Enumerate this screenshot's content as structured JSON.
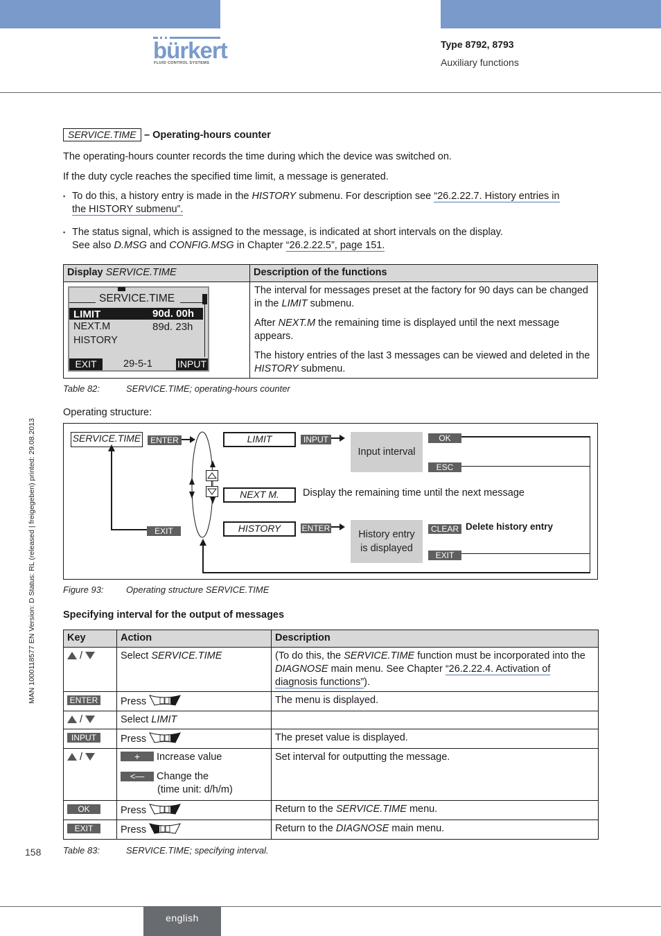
{
  "header": {
    "brand": "bürkert",
    "brand_tagline": "FLUID CONTROL SYSTEMS",
    "doc_type": "Type 8792, 8793",
    "section": "Auxiliary functions",
    "colors": {
      "band": "#7a9acb",
      "key_bg": "#5f5f5f",
      "gray_box": "#cfcfcf",
      "link_underline": "#4f79b8"
    }
  },
  "side_note": "MAN  1000118577  EN  Version: D  Status: RL (released | freigegeben)  printed: 29.08.2013",
  "intro": {
    "function_box": "SERVICE.TIME",
    "heading": "– Operating-hours counter",
    "p1": "The operating-hours counter records the time during which the device was switched on.",
    "p2": "If the duty cycle reaches the specified time limit, a message is generated.",
    "bullet1": {
      "pre": "To do this, a history entry is made in the ",
      "em": "HISTORY",
      "mid": " submenu. For description see ",
      "link1": "“26.2.22.7. History entries in ",
      "link2": "the HISTORY submenu”."
    },
    "bullet2": {
      "line1": "The status signal, which is assigned to the message, is indicated at short intervals on the display.",
      "pre": "See also ",
      "em1": "D.MSG",
      "and": " and ",
      "em2": "CONFIG.MSG",
      "mid": " in Chapter ",
      "link": "“26.2.22.5”, page 151."
    }
  },
  "table82": {
    "header_display": "Display ",
    "header_display_em": "SERVICE.TIME",
    "header_desc": "Description of the functions",
    "lcd": {
      "title": "SERVICE.TIME",
      "rows": [
        {
          "label": "LIMIT",
          "value": "90d. 00h",
          "selected": true
        },
        {
          "label": "NEXT.M",
          "value": "89d. 23h",
          "selected": false
        },
        {
          "label": "HISTORY",
          "value": "",
          "selected": false
        }
      ],
      "left_key": "EXIT",
      "code": "29-5-1",
      "right_key": "INPUT"
    },
    "desc": [
      {
        "pre": "The interval for messages preset at the factory for 90 days can be changed in the ",
        "em": "LIMIT",
        "post": " submenu."
      },
      {
        "pre": "After ",
        "em": "NEXT.M",
        "post": " the remaining time is displayed until the next message appears."
      },
      {
        "pre": "The history entries of the last 3 messages can be viewed and deleted in the ",
        "em": "HISTORY",
        "post": " submenu."
      }
    ],
    "caption_num": "Table 82:",
    "caption_text": "SERVICE.TIME; operating-hours counter"
  },
  "operating_structure_label": "Operating structure:",
  "figure93": {
    "root": "SERVICE.TIME",
    "enter": "ENTER",
    "exit": "EXIT",
    "items": [
      "LIMIT",
      "NEXT M.",
      "HISTORY"
    ],
    "limit_key": "INPUT",
    "limit_box": "Input interval",
    "ok": "OK",
    "esc": "ESC",
    "next_text": "Display the remaining time until the next message",
    "history_key": "ENTER",
    "history_box_l1": "History entry",
    "history_box_l2": "is displayed",
    "clear": "CLEAR",
    "clear_text": "Delete history entry",
    "history_exit": "EXIT",
    "caption_num": "Figure 93:",
    "caption_text": "Operating structure SERVICE.TIME"
  },
  "section2_heading": "Specifying interval for the output of messages",
  "table83": {
    "headers": [
      "Key",
      "Action",
      "Description"
    ],
    "rows": [
      {
        "key": "▲ / ▼",
        "action_pre": "Select ",
        "action_em": "SERVICE.TIME",
        "desc_pre": "(To do this, the ",
        "desc_em1": "SERVICE.TIME",
        "desc_mid1": " function must be incorporated into the ",
        "desc_em2": "DIAGNOSE",
        "desc_mid2": " main menu. See Chapter ",
        "desc_link": "“26.2.22.4. Activation of diagnosis functions”",
        "desc_post": ")."
      },
      {
        "key": "ENTER",
        "action_pre": "Press",
        "keypad": "right-active",
        "desc": "The menu is displayed."
      },
      {
        "key": "▲ / ▼",
        "action_pre": "Select ",
        "action_em": "LIMIT",
        "desc": ""
      },
      {
        "key": "INPUT",
        "action_pre": "Press",
        "keypad": "right-active",
        "desc": "The preset value is displayed."
      },
      {
        "key": "▲ / ▼",
        "btn1": "+",
        "btn1_text": "Increase value",
        "btn2": "<—",
        "btn2_text": "Change the",
        "btn2_text2": "(time unit: d/h/m)",
        "desc": "Set interval for outputting the message."
      },
      {
        "key": "OK",
        "action_pre": "Press",
        "keypad": "right-active",
        "desc_pre": "Return to the ",
        "desc_em": "SERVICE.TIME",
        "desc_post": " menu."
      },
      {
        "key": "EXIT",
        "action_pre": "Press",
        "keypad": "left-active",
        "desc_pre": "Return to the ",
        "desc_em": "DIAGNOSE",
        "desc_post": " main menu."
      }
    ],
    "caption_num": "Table 83:",
    "caption_text": "SERVICE.TIME; specifying interval."
  },
  "footer": {
    "page_number": "158",
    "language": "english"
  }
}
